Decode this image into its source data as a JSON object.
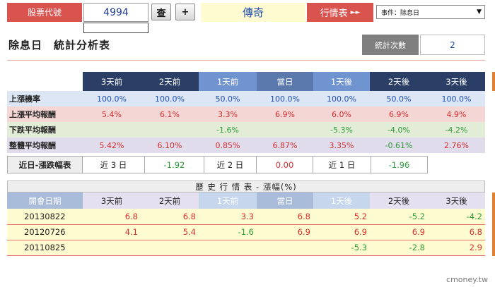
{
  "header": {
    "stock_code_label": "股票代號",
    "stock_code_value": "4994",
    "query_button": "查",
    "add_button": "+",
    "stock_name": "傳奇",
    "quote_label": "行情表",
    "quote_arrows": "►►",
    "event_select_value": "事件：除息日"
  },
  "title": "除息日　統計分析表",
  "stat_count": {
    "label": "統計次數",
    "value": "2"
  },
  "stats": {
    "columns": [
      "3天前",
      "2天前",
      "1天前",
      "當日",
      "1天後",
      "2天後",
      "3天後"
    ],
    "rows": [
      {
        "label": "上漲機率",
        "cells": [
          "100.0%",
          "100.0%",
          "50.0%",
          "100.0%",
          "100.0%",
          "50.0%",
          "100.0%"
        ]
      },
      {
        "label": "上漲平均報酬",
        "cells": [
          "5.4%",
          "6.1%",
          "3.3%",
          "6.9%",
          "6.0%",
          "6.9%",
          "4.9%"
        ]
      },
      {
        "label": "下跌平均報酬",
        "cells": [
          "",
          "",
          "-1.6%",
          "",
          "-5.3%",
          "-4.0%",
          "-4.2%"
        ]
      },
      {
        "label": "整體平均報酬",
        "cells": [
          "5.42%",
          "6.10%",
          "0.85%",
          "6.87%",
          "3.35%",
          "-0.61%",
          "2.76%"
        ]
      }
    ]
  },
  "recent": {
    "label": "近日-漲跌幅表",
    "items": [
      {
        "label": "近 3 日",
        "value": "-1.92"
      },
      {
        "label": "近 2 日",
        "value": "0.00"
      },
      {
        "label": "近 1 日",
        "value": "-1.96"
      }
    ]
  },
  "history": {
    "title": "歷 史 行 情 表 - 漲幅(%)",
    "columns": [
      "開會日期",
      "3天前",
      "2天前",
      "1天前",
      "當日",
      "1天後",
      "2天後",
      "3天後"
    ],
    "rows": [
      {
        "date": "20130822",
        "cells": [
          "6.8",
          "6.8",
          "3.3",
          "6.8",
          "5.2",
          "-5.2",
          "-4.2"
        ]
      },
      {
        "date": "20120726",
        "cells": [
          "4.1",
          "5.4",
          "-1.6",
          "6.9",
          "6.9",
          "6.9",
          "6.8"
        ]
      },
      {
        "date": "20110825",
        "cells": [
          "",
          "",
          "",
          "",
          "-5.3",
          "-2.8",
          "2.9"
        ]
      }
    ]
  },
  "watermark": "cmoney.tw"
}
